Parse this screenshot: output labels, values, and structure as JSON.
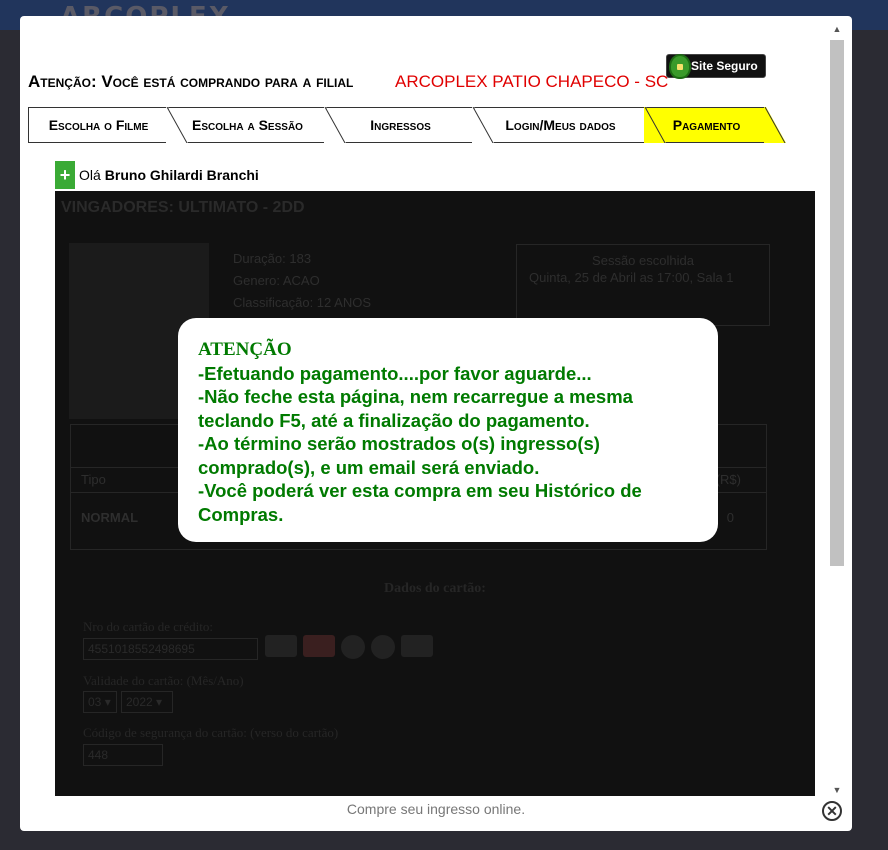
{
  "header": {
    "notice": "Atenção: Você está comprando para a filial",
    "branch": "ARCOPLEX PATIO CHAPECO - SC",
    "secure_seal": "Site Seguro"
  },
  "tabs": [
    {
      "label": "Escolha o Filme"
    },
    {
      "label": "Escolha a Sessão"
    },
    {
      "label": "Ingressos"
    },
    {
      "label": "Login/Meus dados"
    },
    {
      "label": "Pagamento"
    }
  ],
  "greeting": {
    "prefix": "Olá",
    "name": "Bruno Ghilardi Branchi"
  },
  "movie": {
    "title": "VINGADORES: ULTIMATO - 2DD",
    "duration": "Duração: 183",
    "genre": "Genero: ACAO",
    "rating": "Classificação: 12 ANOS"
  },
  "session": {
    "title": "Sessão escolhida",
    "detail": "Quinta, 25 de Abril as 17:00, Sala 1"
  },
  "tickets": {
    "type_header": "Tipo",
    "value_header": "(R$)",
    "type": "NORMAL",
    "value": "0"
  },
  "card": {
    "section_title": "Dados do cartão:",
    "number_label": "Nro do cartão de crédito:",
    "number_value": "4551018552498695",
    "expiry_label": "Validade do cartão: (Mês/Ano)",
    "month": "03",
    "year": "2022",
    "cvv_label": "Código de segurança do cartão: (verso do cartão)",
    "cvv_value": "448"
  },
  "overlay": {
    "title": "ATENÇÃO",
    "lines": [
      "-Efetuando pagamento....por favor aguarde...",
      "-Não feche esta página, nem recarregue a mesma teclando F5, até a finalização do pagamento.",
      "-Ao término serão mostrados o(s) ingresso(s) comprado(s), e um email será enviado.",
      "-Você poderá ver esta compra em seu Histórico de Compras."
    ]
  },
  "footer": "Compre seu ingresso online.",
  "colors": {
    "branch": "#e00000",
    "active_tab": "#ffff00",
    "overlay_text": "#007a00",
    "plus": "#3aaa35"
  }
}
